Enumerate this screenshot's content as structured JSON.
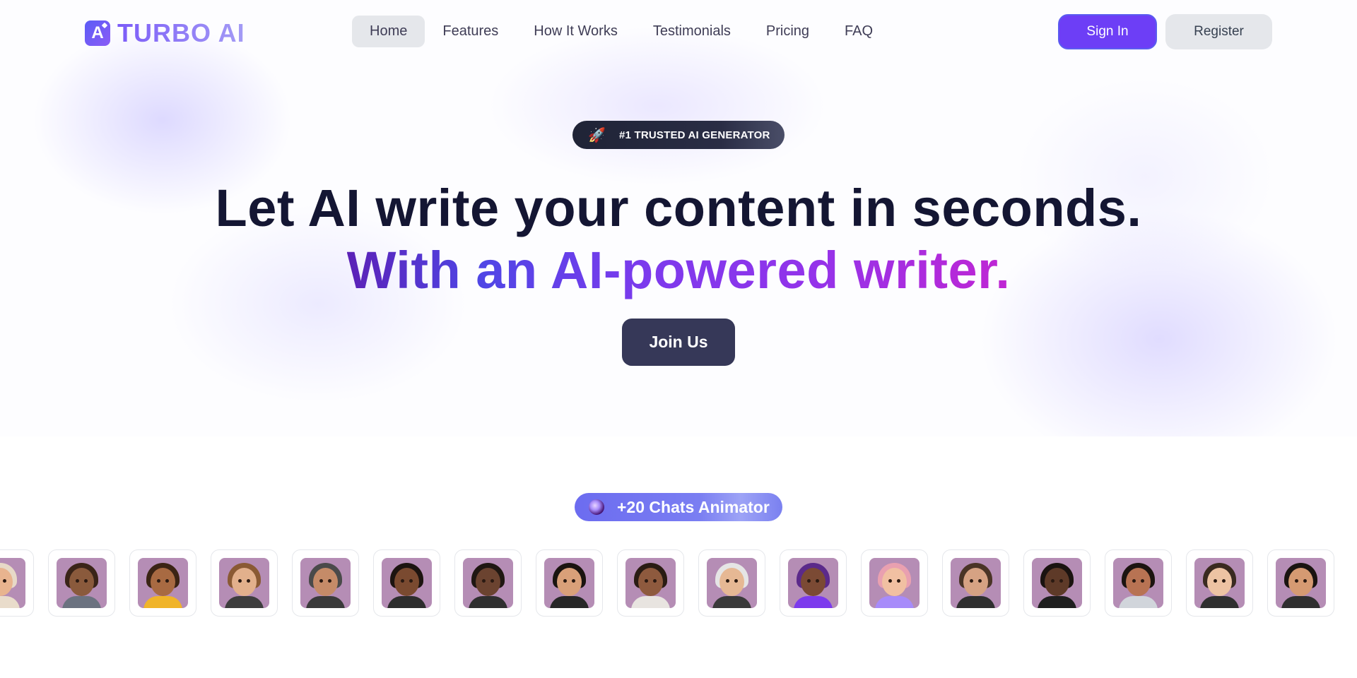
{
  "header": {
    "logo_text": "TURBO AI",
    "logo_mark": "A",
    "nav": [
      {
        "label": "Home",
        "active": true
      },
      {
        "label": "Features",
        "active": false
      },
      {
        "label": "How It Works",
        "active": false
      },
      {
        "label": "Testimonials",
        "active": false
      },
      {
        "label": "Pricing",
        "active": false
      },
      {
        "label": "FAQ",
        "active": false
      }
    ],
    "sign_in": "Sign In",
    "register": "Register"
  },
  "hero": {
    "badge_icon": "rocket-icon",
    "badge_text": "#1 TRUSTED AI GENERATOR",
    "headline": "Let AI write your content in seconds.",
    "subline": "With an AI-powered writer.",
    "cta": "Join Us"
  },
  "chats": {
    "badge_icon": "crystal-ball-icon",
    "badge_text": "+20 Chats Animator",
    "avatars": [
      {
        "skin": "#e8b48f",
        "hair": "#e7d9c7",
        "body": "#e9dccb"
      },
      {
        "skin": "#8a5a3c",
        "hair": "#3a2418",
        "body": "#6b7280"
      },
      {
        "skin": "#a86a42",
        "hair": "#3b2414",
        "body": "#f0b429"
      },
      {
        "skin": "#e2b08c",
        "hair": "#8a5a34",
        "body": "#3d3d3d"
      },
      {
        "skin": "#c58b68",
        "hair": "#4a4a4a",
        "body": "#3a3a3a"
      },
      {
        "skin": "#7a4a30",
        "hair": "#1c1410",
        "body": "#2d2d2d"
      },
      {
        "skin": "#6b4330",
        "hair": "#1f1712",
        "body": "#2f2f2f"
      },
      {
        "skin": "#d9a079",
        "hair": "#1a1410",
        "body": "#262626"
      },
      {
        "skin": "#8e5a3e",
        "hair": "#2a1c14",
        "body": "#e8e4e0"
      },
      {
        "skin": "#e6b894",
        "hair": "#e5e5e5",
        "body": "#3a3a3a"
      },
      {
        "skin": "#7b4a34",
        "hair": "#5b2a8a",
        "body": "#7c3aed"
      },
      {
        "skin": "#f1c0a2",
        "hair": "#e9a0b0",
        "body": "#a78bfa"
      },
      {
        "skin": "#d6a283",
        "hair": "#4a3426",
        "body": "#2f2f2f"
      },
      {
        "skin": "#5e3a28",
        "hair": "#1a1310",
        "body": "#1f1f1f"
      },
      {
        "skin": "#b87353",
        "hair": "#1c1410",
        "body": "#d1d5db"
      },
      {
        "skin": "#edc3a3",
        "hair": "#3a2a20",
        "body": "#2f2f2f"
      },
      {
        "skin": "#d59a72",
        "hair": "#1a1410",
        "body": "#2f2f2f"
      }
    ]
  },
  "colors": {
    "accent": "#6d3ef6",
    "cta": "#363858",
    "headline": "#141633",
    "avatar_bg": "#b58db5"
  }
}
